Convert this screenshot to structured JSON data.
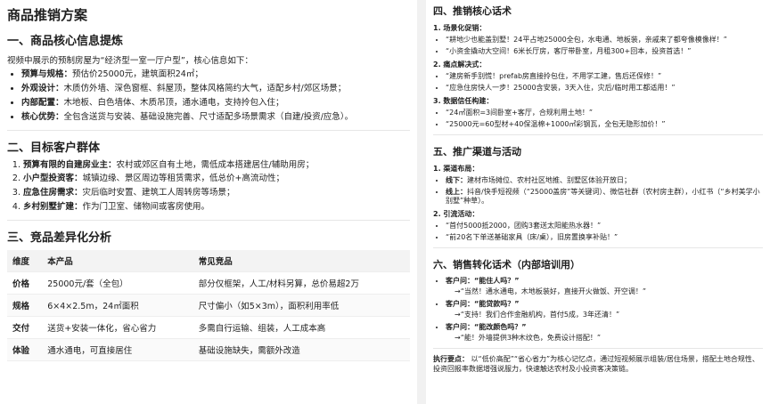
{
  "left": {
    "title": "商品推销方案",
    "sec1": {
      "heading": "一、商品核心信息提炼",
      "intro": "视频中展示的预制房屋为“经济型一室一厅户型”，核心信息如下：",
      "items": [
        {
          "key": "预算与规格：",
          "text": "预估价25000元，建筑面积24㎡；"
        },
        {
          "key": "外观设计：",
          "text": "木质仿外墙、深色窗框、斜屋顶，整体风格简约大气，适配乡村/郊区场景；"
        },
        {
          "key": "内部配置：",
          "text": "木地板、白色墙体、木质吊顶，通水通电，支持拎包入住；"
        },
        {
          "key": "核心优势：",
          "text": "全包含送货与安装、基础设施完善、尺寸适配多场景需求（自建/投资/应急）。"
        }
      ]
    },
    "sec2": {
      "heading": "二、目标客户群体",
      "items": [
        {
          "key": "预算有限的自建房业主：",
          "text": "农村或郊区自有土地，需低成本搭建居住/辅助用房；"
        },
        {
          "key": "小户型投资客：",
          "text": "城镇边缘、景区周边等租赁需求，低总价+高流动性；"
        },
        {
          "key": "应急住房需求：",
          "text": "灾后临时安置、建筑工人周转房等场景；"
        },
        {
          "key": "乡村别墅扩建：",
          "text": "作为门卫室、储物间或客房使用。"
        }
      ]
    },
    "sec3": {
      "heading": "三、竞品差异化分析",
      "columns": [
        "维度",
        "本产品",
        "常见竞品"
      ],
      "rows": [
        [
          "价格",
          "25000元/套（全包）",
          "部分仅框架，人工/材料另算，总价易超2万"
        ],
        [
          "规格",
          "6×4×2.5m，24㎡面积",
          "尺寸偏小（如5×3m），面积利用率低"
        ],
        [
          "交付",
          "送货+安装一体化，省心省力",
          "多需自行运输、组装，人工成本高"
        ],
        [
          "体验",
          "通水通电，可直接居住",
          "基础设施缺失，需额外改造"
        ]
      ]
    }
  },
  "right": {
    "sec4": {
      "heading": "四、推销核心话术",
      "groups": [
        {
          "title": "1. 场景化促销：",
          "lines": [
            "“耕地少也能盖别墅！24平占地25000全包，水电通、地板装，亲戚来了都夸像模像样！”",
            "“小资金撬动大空间！6米长厅房，客厅带卧室，月租300+回本，投资首选！”"
          ]
        },
        {
          "title": "2. 痛点解决式：",
          "lines": [
            "“建房新手别慌！prefab房直接拎包住，不用学工建，售后还保修！”",
            "“应急住房快人一步！25000含安装，3天入住，灾后/临时用工都适用！”"
          ]
        },
        {
          "title": "3. 数据信任构建：",
          "lines": [
            "“24㎡面积=3间卧室+客厅，合规利用土地！”",
            "“25000元=60型材+40保温棉+1000㎡彩钢瓦，全包无隐形加价！”"
          ]
        }
      ]
    },
    "sec5": {
      "heading": "五、推广渠道与活动",
      "groups": [
        {
          "title": "1. 渠道布局：",
          "lines": [
            {
              "key": "线下：",
              "text": "建材市场摊位、农村社区地推、别墅区体验开放日；"
            },
            {
              "key": "线上：",
              "text": "抖音/快手短视频（“25000盖房”等关键词）、微信社群（农村房主群），小红书（“乡村美学小别墅”种草）。"
            }
          ]
        },
        {
          "title": "2. 引流活动：",
          "lines": [
            {
              "key": "",
              "text": "“首付5000抵2000，团购3套送太阳能热水器！”"
            },
            {
              "key": "",
              "text": "“前20名下单送基础家具（床/桌），旧房置换享补贴！”"
            }
          ]
        }
      ]
    },
    "sec6": {
      "heading": "六、销售转化话术（内部培训用）",
      "qa": [
        {
          "q": "客户问：“能住人吗？”",
          "a": "→“当然！通水通电，木地板装好，直接开火做饭、开空调！”"
        },
        {
          "q": "客户问：“能贷款吗？”",
          "a": "→“支持！我们合作金融机构，首付5成，3年还清！”"
        },
        {
          "q": "客户问：“能改颜色吗？”",
          "a": "→“能！外墙提供3种木纹色，免费设计搭配！”"
        }
      ]
    },
    "exec": {
      "key": "执行要点：",
      "text": "以“低价高配”“省心省力”为核心记忆点，通过短视频展示组装/居住场景，搭配土地合规性、投资回报率数据增强说服力，快速触达农村及小投资客决策链。"
    }
  }
}
